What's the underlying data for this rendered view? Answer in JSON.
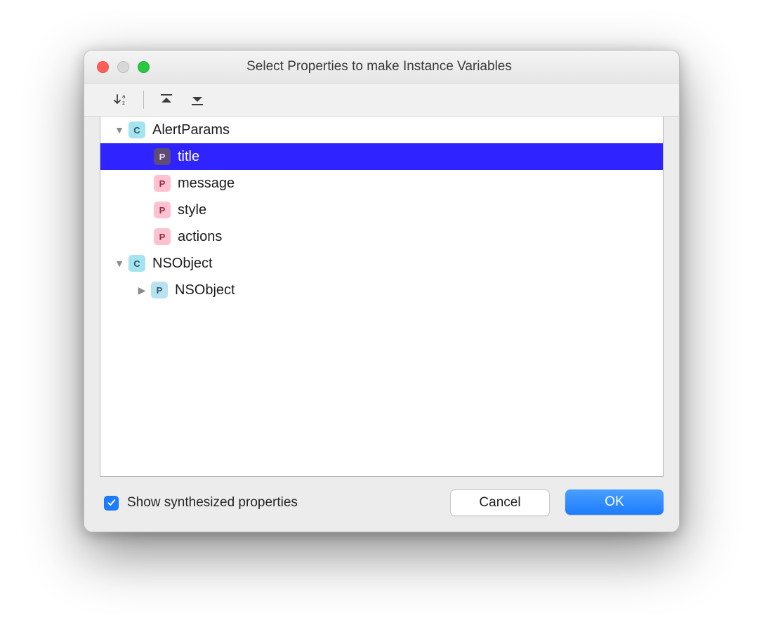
{
  "window": {
    "title": "Select Properties to make Instance Variables"
  },
  "toolbar": {
    "sort": "Sort",
    "expand": "Expand All",
    "collapse": "Collapse All"
  },
  "tree": [
    {
      "kind": "class",
      "icon": "C",
      "label": "AlertParams",
      "depth": 0,
      "expanded": true,
      "selected": false
    },
    {
      "kind": "property",
      "icon": "P",
      "label": "title",
      "depth": 1,
      "selected": true
    },
    {
      "kind": "property",
      "icon": "P",
      "label": "message",
      "depth": 1,
      "selected": false
    },
    {
      "kind": "property",
      "icon": "P",
      "label": "style",
      "depth": 1,
      "selected": false
    },
    {
      "kind": "property",
      "icon": "P",
      "label": "actions",
      "depth": 1,
      "selected": false
    },
    {
      "kind": "class",
      "icon": "C",
      "label": "NSObject",
      "depth": 0,
      "expanded": true,
      "selected": false
    },
    {
      "kind": "protocol",
      "icon": "P",
      "label": "NSObject",
      "depth": 1,
      "expanded": false,
      "selected": false
    }
  ],
  "footer": {
    "checkbox_label": "Show synthesized properties",
    "checkbox_checked": true,
    "cancel": "Cancel",
    "ok": "OK"
  }
}
